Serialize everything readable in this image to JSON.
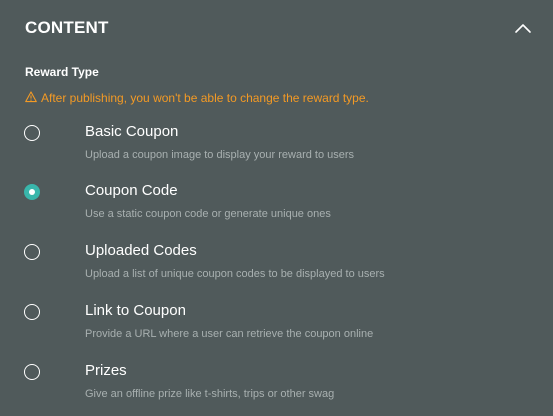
{
  "section": {
    "title": "CONTENT",
    "collapse_icon": "chevron-up-icon"
  },
  "reward_type": {
    "label": "Reward Type",
    "warning": "After publishing, you won't be able to change the reward type.",
    "warning_icon": "warning-triangle-icon",
    "warning_color": "#f39a25",
    "accent_color": "#39b6ab",
    "selected": "Coupon Code",
    "options": [
      {
        "title": "Basic Coupon",
        "description": "Upload a coupon image to display your reward to users",
        "checked": false
      },
      {
        "title": "Coupon Code",
        "description": "Use a static coupon code or generate unique ones",
        "checked": true
      },
      {
        "title": "Uploaded Codes",
        "description": "Upload a list of unique coupon codes to be displayed to users",
        "checked": false
      },
      {
        "title": "Link to Coupon",
        "description": "Provide a URL where a user can retrieve the coupon online",
        "checked": false
      },
      {
        "title": "Prizes",
        "description": "Give an offline prize like t-shirts, trips or other swag",
        "checked": false
      }
    ]
  }
}
